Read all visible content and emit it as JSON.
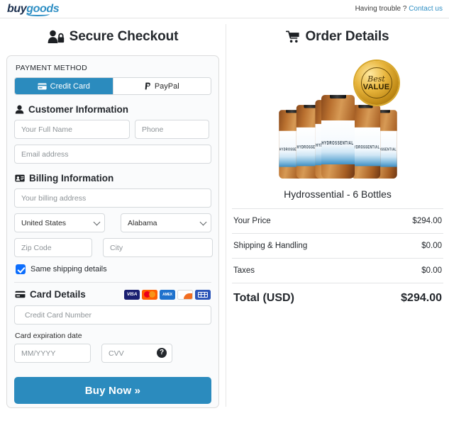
{
  "header": {
    "logo_buy": "buy",
    "logo_goods": "goods",
    "help_text": "Having trouble ?",
    "contact_link": "Contact us"
  },
  "checkout": {
    "title": "Secure Checkout",
    "payment_method_label": "PAYMENT METHOD",
    "tabs": [
      {
        "label": "Credit Card",
        "icon": "credit-card-icon",
        "active": true
      },
      {
        "label": "PayPal",
        "icon": "paypal-icon",
        "active": false
      }
    ],
    "customer": {
      "heading": "Customer Information",
      "full_name_placeholder": "Your Full Name",
      "full_name_value": "",
      "phone_placeholder": "Phone",
      "phone_value": "",
      "email_placeholder": "Email address",
      "email_value": ""
    },
    "billing": {
      "heading": "Billing Information",
      "address_placeholder": "Your billing address",
      "address_value": "",
      "country_value": "United States",
      "state_value": "Alabama",
      "zip_placeholder": "Zip Code",
      "zip_value": "",
      "city_placeholder": "City",
      "city_value": "",
      "same_shipping_label": "Same shipping details",
      "same_shipping_checked": true
    },
    "card": {
      "heading": "Card Details",
      "brands": [
        "VISA",
        "Mastercard",
        "AMEX",
        "Discover",
        "Card"
      ],
      "brand_labels": {
        "visa": "VISA",
        "amex": "AMEX",
        "discover": "DISCOVER"
      },
      "number_placeholder": "Credit Card Number",
      "number_value": "",
      "expiration_label": "Card expiration date",
      "expiration_placeholder": "MM/YYYY",
      "expiration_value": "",
      "cvv_placeholder": "CVV",
      "cvv_value": "",
      "cvv_help_icon": "question-mark-icon"
    },
    "buy_button": "Buy Now »"
  },
  "order": {
    "title": "Order Details",
    "product_name": "Hydrossential - 6 Bottles",
    "bottle_label_text": "HYDROSSENTIAL",
    "badge": {
      "top_text": "Best",
      "bottom_text": "VALUE"
    },
    "summary": [
      {
        "label": "Your Price",
        "value": "$294.00"
      },
      {
        "label": "Shipping & Handling",
        "value": "$0.00"
      },
      {
        "label": "Taxes",
        "value": "$0.00"
      }
    ],
    "total": {
      "label": "Total (USD)",
      "value": "$294.00"
    }
  },
  "colors": {
    "accent": "#2b8bbe",
    "link": "#2f8fc4",
    "checkbox": "#0d6efd",
    "badge_gold": "#e8b53c"
  }
}
